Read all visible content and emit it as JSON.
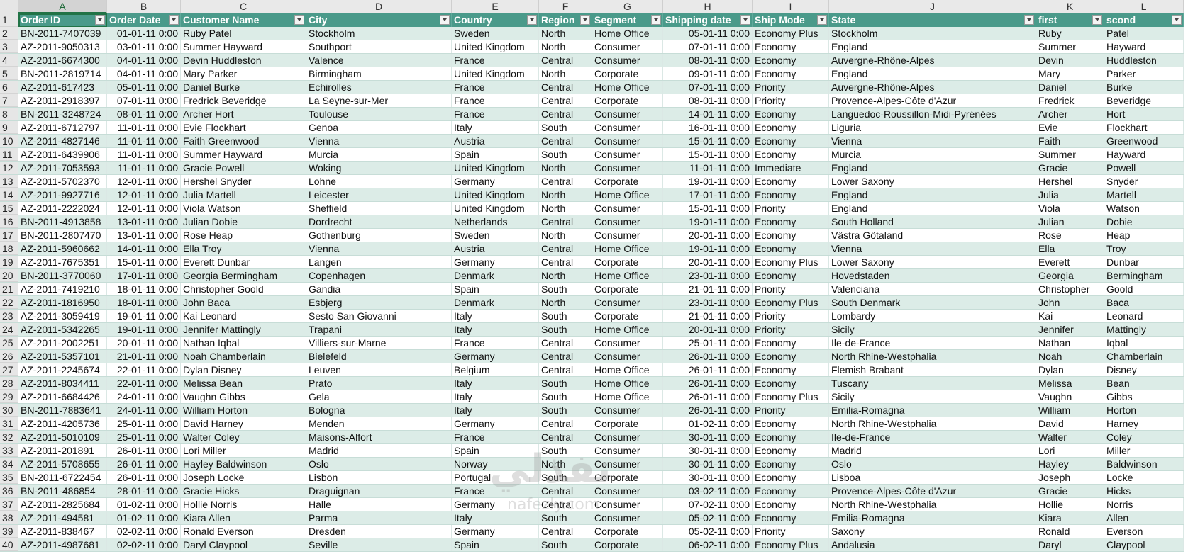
{
  "column_letters": [
    "A",
    "B",
    "C",
    "D",
    "E",
    "F",
    "G",
    "H",
    "I",
    "J",
    "K",
    "L"
  ],
  "selected_column": "A",
  "headers": [
    "Order ID",
    "Order Date",
    "Customer Name",
    "City",
    "Country",
    "Region",
    "Segment",
    "Shipping date",
    "Ship Mode",
    "State",
    "first",
    "scond"
  ],
  "rows": [
    [
      "BN-2011-7407039",
      "01-01-11 0:00",
      "Ruby Patel",
      "Stockholm",
      "Sweden",
      "North",
      "Home Office",
      "05-01-11 0:00",
      "Economy Plus",
      "Stockholm",
      "Ruby",
      "Patel"
    ],
    [
      "AZ-2011-9050313",
      "03-01-11 0:00",
      "Summer Hayward",
      "Southport",
      "United Kingdom",
      "North",
      "Consumer",
      "07-01-11 0:00",
      "Economy",
      "England",
      "Summer",
      "Hayward"
    ],
    [
      "AZ-2011-6674300",
      "04-01-11 0:00",
      "Devin Huddleston",
      "Valence",
      "France",
      "Central",
      "Consumer",
      "08-01-11 0:00",
      "Economy",
      "Auvergne-Rhône-Alpes",
      "Devin",
      "Huddleston"
    ],
    [
      "BN-2011-2819714",
      "04-01-11 0:00",
      "Mary Parker",
      "Birmingham",
      "United Kingdom",
      "North",
      "Corporate",
      "09-01-11 0:00",
      "Economy",
      "England",
      "Mary",
      "Parker"
    ],
    [
      "AZ-2011-617423",
      "05-01-11 0:00",
      "Daniel Burke",
      "Echirolles",
      "France",
      "Central",
      "Home Office",
      "07-01-11 0:00",
      "Priority",
      "Auvergne-Rhône-Alpes",
      "Daniel",
      "Burke"
    ],
    [
      "AZ-2011-2918397",
      "07-01-11 0:00",
      "Fredrick Beveridge",
      "La Seyne-sur-Mer",
      "France",
      "Central",
      "Corporate",
      "08-01-11 0:00",
      "Priority",
      "Provence-Alpes-Côte d'Azur",
      "Fredrick",
      "Beveridge"
    ],
    [
      "BN-2011-3248724",
      "08-01-11 0:00",
      "Archer Hort",
      "Toulouse",
      "France",
      "Central",
      "Consumer",
      "14-01-11 0:00",
      "Economy",
      "Languedoc-Roussillon-Midi-Pyrénées",
      "Archer",
      "Hort"
    ],
    [
      "AZ-2011-6712797",
      "11-01-11 0:00",
      "Evie Flockhart",
      "Genoa",
      "Italy",
      "South",
      "Consumer",
      "16-01-11 0:00",
      "Economy",
      "Liguria",
      "Evie",
      "Flockhart"
    ],
    [
      "AZ-2011-4827146",
      "11-01-11 0:00",
      "Faith Greenwood",
      "Vienna",
      "Austria",
      "Central",
      "Consumer",
      "15-01-11 0:00",
      "Economy",
      "Vienna",
      "Faith",
      "Greenwood"
    ],
    [
      "AZ-2011-6439906",
      "11-01-11 0:00",
      "Summer Hayward",
      "Murcia",
      "Spain",
      "South",
      "Consumer",
      "15-01-11 0:00",
      "Economy",
      "Murcia",
      "Summer",
      "Hayward"
    ],
    [
      "AZ-2011-7053593",
      "11-01-11 0:00",
      "Gracie Powell",
      "Woking",
      "United Kingdom",
      "North",
      "Consumer",
      "11-01-11 0:00",
      "Immediate",
      "England",
      "Gracie",
      "Powell"
    ],
    [
      "AZ-2011-5702370",
      "12-01-11 0:00",
      "Hershel Snyder",
      "Lohne",
      "Germany",
      "Central",
      "Corporate",
      "19-01-11 0:00",
      "Economy",
      "Lower Saxony",
      "Hershel",
      "Snyder"
    ],
    [
      "AZ-2011-9927716",
      "12-01-11 0:00",
      "Julia Martell",
      "Leicester",
      "United Kingdom",
      "North",
      "Home Office",
      "17-01-11 0:00",
      "Economy",
      "England",
      "Julia",
      "Martell"
    ],
    [
      "AZ-2011-2222024",
      "12-01-11 0:00",
      "Viola Watson",
      "Sheffield",
      "United Kingdom",
      "North",
      "Consumer",
      "15-01-11 0:00",
      "Priority",
      "England",
      "Viola",
      "Watson"
    ],
    [
      "BN-2011-4913858",
      "13-01-11 0:00",
      "Julian Dobie",
      "Dordrecht",
      "Netherlands",
      "Central",
      "Consumer",
      "19-01-11 0:00",
      "Economy",
      "South Holland",
      "Julian",
      "Dobie"
    ],
    [
      "BN-2011-2807470",
      "13-01-11 0:00",
      "Rose Heap",
      "Gothenburg",
      "Sweden",
      "North",
      "Consumer",
      "20-01-11 0:00",
      "Economy",
      "Västra Götaland",
      "Rose",
      "Heap"
    ],
    [
      "AZ-2011-5960662",
      "14-01-11 0:00",
      "Ella Troy",
      "Vienna",
      "Austria",
      "Central",
      "Home Office",
      "19-01-11 0:00",
      "Economy",
      "Vienna",
      "Ella",
      "Troy"
    ],
    [
      "AZ-2011-7675351",
      "15-01-11 0:00",
      "Everett Dunbar",
      "Langen",
      "Germany",
      "Central",
      "Corporate",
      "20-01-11 0:00",
      "Economy Plus",
      "Lower Saxony",
      "Everett",
      "Dunbar"
    ],
    [
      "BN-2011-3770060",
      "17-01-11 0:00",
      "Georgia Bermingham",
      "Copenhagen",
      "Denmark",
      "North",
      "Home Office",
      "23-01-11 0:00",
      "Economy",
      "Hovedstaden",
      "Georgia",
      "Bermingham"
    ],
    [
      "AZ-2011-7419210",
      "18-01-11 0:00",
      "Christopher Goold",
      "Gandia",
      "Spain",
      "South",
      "Corporate",
      "21-01-11 0:00",
      "Priority",
      "Valenciana",
      "Christopher",
      "Goold"
    ],
    [
      "AZ-2011-1816950",
      "18-01-11 0:00",
      "John Baca",
      "Esbjerg",
      "Denmark",
      "North",
      "Consumer",
      "23-01-11 0:00",
      "Economy Plus",
      "South Denmark",
      "John",
      "Baca"
    ],
    [
      "AZ-2011-3059419",
      "19-01-11 0:00",
      "Kai Leonard",
      "Sesto San Giovanni",
      "Italy",
      "South",
      "Corporate",
      "21-01-11 0:00",
      "Priority",
      "Lombardy",
      "Kai",
      "Leonard"
    ],
    [
      "AZ-2011-5342265",
      "19-01-11 0:00",
      "Jennifer Mattingly",
      "Trapani",
      "Italy",
      "South",
      "Home Office",
      "20-01-11 0:00",
      "Priority",
      "Sicily",
      "Jennifer",
      "Mattingly"
    ],
    [
      "AZ-2011-2002251",
      "20-01-11 0:00",
      "Nathan Iqbal",
      "Villiers-sur-Marne",
      "France",
      "Central",
      "Consumer",
      "25-01-11 0:00",
      "Economy",
      "Ile-de-France",
      "Nathan",
      "Iqbal"
    ],
    [
      "AZ-2011-5357101",
      "21-01-11 0:00",
      "Noah Chamberlain",
      "Bielefeld",
      "Germany",
      "Central",
      "Consumer",
      "26-01-11 0:00",
      "Economy",
      "North Rhine-Westphalia",
      "Noah",
      "Chamberlain"
    ],
    [
      "AZ-2011-2245674",
      "22-01-11 0:00",
      "Dylan Disney",
      "Leuven",
      "Belgium",
      "Central",
      "Home Office",
      "26-01-11 0:00",
      "Economy",
      "Flemish Brabant",
      "Dylan",
      "Disney"
    ],
    [
      "AZ-2011-8034411",
      "22-01-11 0:00",
      "Melissa Bean",
      "Prato",
      "Italy",
      "South",
      "Home Office",
      "26-01-11 0:00",
      "Economy",
      "Tuscany",
      "Melissa",
      "Bean"
    ],
    [
      "AZ-2011-6684426",
      "24-01-11 0:00",
      "Vaughn Gibbs",
      "Gela",
      "Italy",
      "South",
      "Home Office",
      "26-01-11 0:00",
      "Economy Plus",
      "Sicily",
      "Vaughn",
      "Gibbs"
    ],
    [
      "BN-2011-7883641",
      "24-01-11 0:00",
      "William Horton",
      "Bologna",
      "Italy",
      "South",
      "Consumer",
      "26-01-11 0:00",
      "Priority",
      "Emilia-Romagna",
      "William",
      "Horton"
    ],
    [
      "AZ-2011-4205736",
      "25-01-11 0:00",
      "David Harney",
      "Menden",
      "Germany",
      "Central",
      "Corporate",
      "01-02-11 0:00",
      "Economy",
      "North Rhine-Westphalia",
      "David",
      "Harney"
    ],
    [
      "AZ-2011-5010109",
      "25-01-11 0:00",
      "Walter Coley",
      "Maisons-Alfort",
      "France",
      "Central",
      "Consumer",
      "30-01-11 0:00",
      "Economy",
      "Ile-de-France",
      "Walter",
      "Coley"
    ],
    [
      "AZ-2011-201891",
      "26-01-11 0:00",
      "Lori Miller",
      "Madrid",
      "Spain",
      "South",
      "Consumer",
      "30-01-11 0:00",
      "Economy",
      "Madrid",
      "Lori",
      "Miller"
    ],
    [
      "AZ-2011-5708655",
      "26-01-11 0:00",
      "Hayley Baldwinson",
      "Oslo",
      "Norway",
      "North",
      "Consumer",
      "30-01-11 0:00",
      "Economy",
      "Oslo",
      "Hayley",
      "Baldwinson"
    ],
    [
      "BN-2011-6722454",
      "26-01-11 0:00",
      "Joseph Locke",
      "Lisbon",
      "Portugal",
      "South",
      "Corporate",
      "30-01-11 0:00",
      "Economy",
      "Lisboa",
      "Joseph",
      "Locke"
    ],
    [
      "BN-2011-486854",
      "28-01-11 0:00",
      "Gracie Hicks",
      "Draguignan",
      "France",
      "Central",
      "Consumer",
      "03-02-11 0:00",
      "Economy",
      "Provence-Alpes-Côte d'Azur",
      "Gracie",
      "Hicks"
    ],
    [
      "AZ-2011-2825684",
      "01-02-11 0:00",
      "Hollie Norris",
      "Halle",
      "Germany",
      "Central",
      "Consumer",
      "07-02-11 0:00",
      "Economy",
      "North Rhine-Westphalia",
      "Hollie",
      "Norris"
    ],
    [
      "AZ-2011-494581",
      "01-02-11 0:00",
      "Kiara Allen",
      "Parma",
      "Italy",
      "South",
      "Consumer",
      "05-02-11 0:00",
      "Economy",
      "Emilia-Romagna",
      "Kiara",
      "Allen"
    ],
    [
      "AZ-2011-838467",
      "02-02-11 0:00",
      "Ronald Everson",
      "Dresden",
      "Germany",
      "Central",
      "Corporate",
      "05-02-11 0:00",
      "Priority",
      "Saxony",
      "Ronald",
      "Everson"
    ],
    [
      "AZ-2011-4987681",
      "02-02-11 0:00",
      "Daryl Claypool",
      "Seville",
      "Spain",
      "South",
      "Corporate",
      "06-02-11 0:00",
      "Economy Plus",
      "Andalusia",
      "Daryl",
      "Claypool"
    ]
  ],
  "watermark": "نفذلي",
  "watermark_sub": "nafezly.com"
}
